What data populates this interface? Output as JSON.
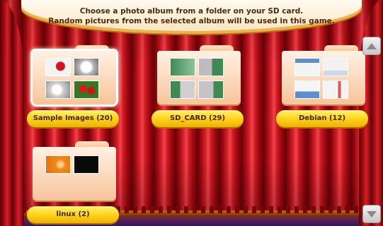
{
  "header": {
    "instruction_line1": "Choose a photo album from a folder on your SD card.",
    "instruction_line2": "Random pictures from the selected album will be used in this game."
  },
  "albums": [
    {
      "label": "Sample Images (20)",
      "selected": true,
      "thumbnails": [
        "red-rose",
        "white-rose",
        "white-flower",
        "red-flowers"
      ]
    },
    {
      "label": "SD_CARD (29)",
      "selected": false,
      "thumbnails": [
        "green-screenshot",
        "gray-screenshot",
        "green-screenshot",
        "gray-screenshot"
      ]
    },
    {
      "label": "Debian (12)",
      "selected": false,
      "thumbnails": [
        "white-screenshot",
        "white-screenshot",
        "white-screenshot",
        "white-screenshot"
      ]
    },
    {
      "label": "linux (2)",
      "selected": false,
      "thumbnails": [
        "orange-swirl",
        "black-image"
      ]
    }
  ],
  "scroll": {
    "up_icon": "triangle-up-icon",
    "down_icon": "triangle-down-icon"
  },
  "colors": {
    "curtain": "#d6202a",
    "label_button": "#ffd21a",
    "header_text": "#4a2a10"
  }
}
